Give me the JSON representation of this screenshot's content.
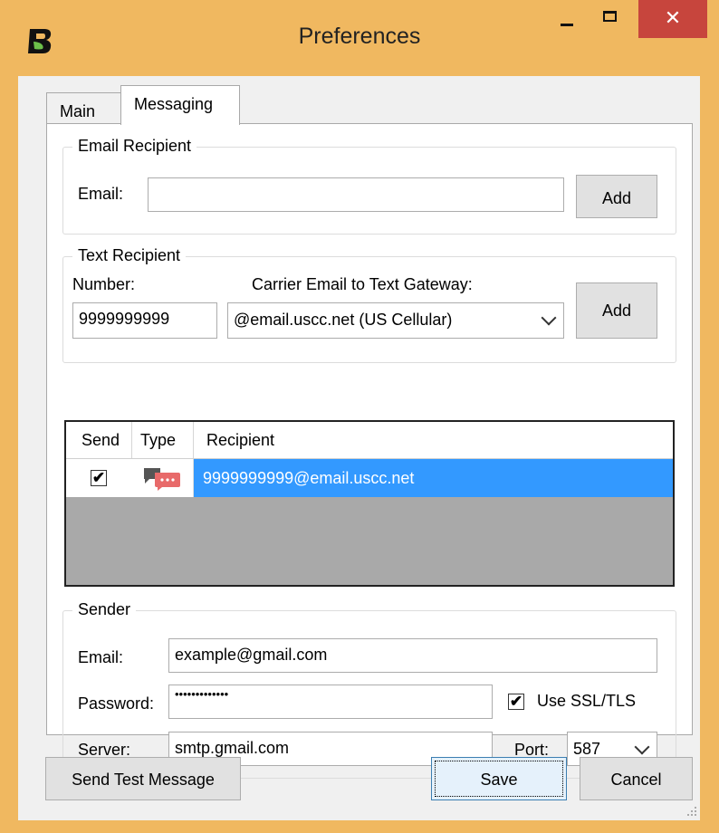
{
  "window": {
    "title": "Preferences",
    "close_glyph": "✕",
    "accent_color": "#f0b860",
    "close_color": "#c7453d"
  },
  "tabs": [
    {
      "label": "Main",
      "selected": false
    },
    {
      "label": "Messaging",
      "selected": true
    }
  ],
  "email_recipient": {
    "legend": "Email Recipient",
    "email_label": "Email:",
    "email_value": "",
    "add_label": "Add"
  },
  "text_recipient": {
    "legend": "Text Recipient",
    "number_label": "Number:",
    "number_value": "9999999999",
    "gateway_label": "Carrier Email to Text Gateway:",
    "gateway_value": "@email.uscc.net (US Cellular)",
    "add_label": "Add"
  },
  "recipients_table": {
    "columns": [
      "Send",
      "Type",
      "Recipient"
    ],
    "rows": [
      {
        "send": true,
        "type_icon": "text-message-icon",
        "recipient": "9999999999@email.uscc.net",
        "selected": true
      }
    ],
    "selection_color": "#3399ff"
  },
  "sender": {
    "legend": "Sender",
    "email_label": "Email:",
    "email_value": "example@gmail.com",
    "password_label": "Password:",
    "password_value": "•••••••••••••",
    "ssl_label": "Use SSL/TLS",
    "ssl_checked": true,
    "server_label": "Server:",
    "server_value": "smtp.gmail.com",
    "port_label": "Port:",
    "port_value": "587"
  },
  "footer": {
    "send_test_label": "Send Test Message",
    "save_label": "Save",
    "cancel_label": "Cancel"
  }
}
